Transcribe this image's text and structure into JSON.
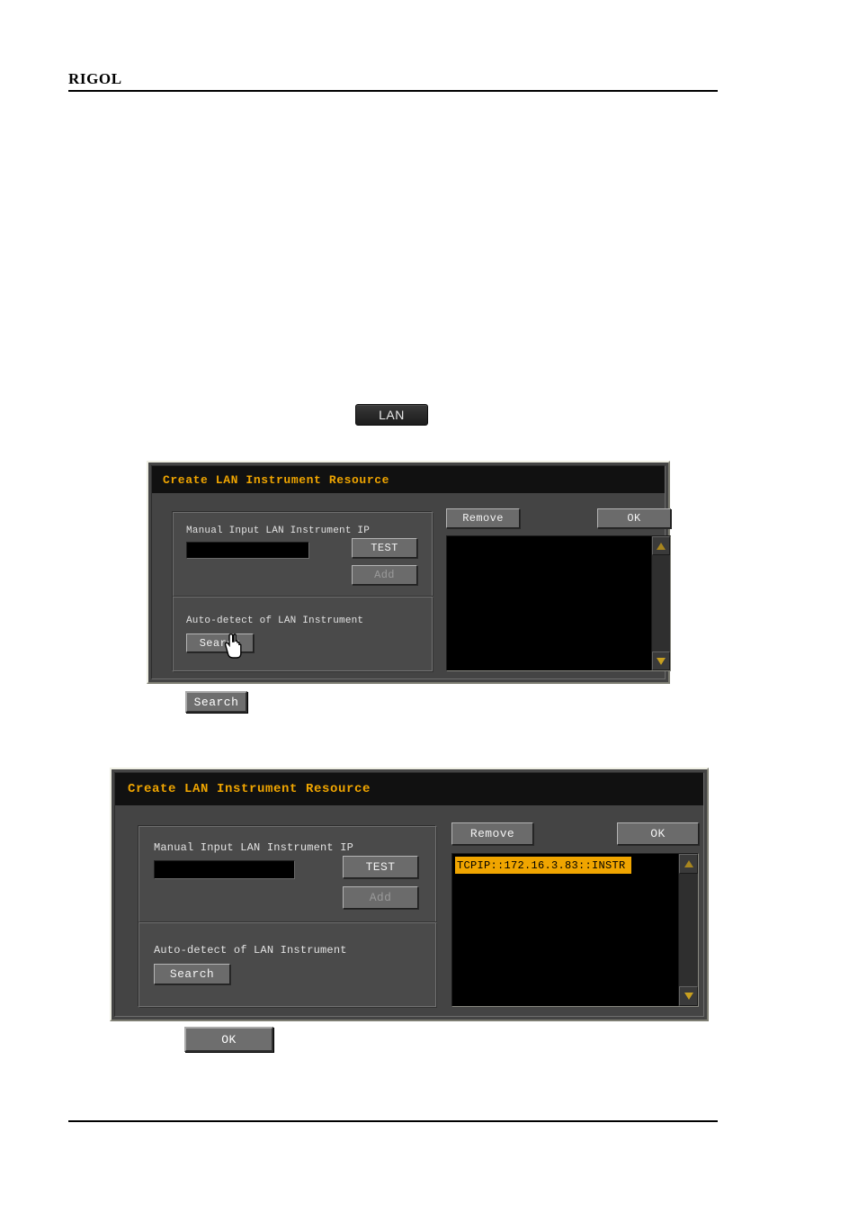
{
  "page": {
    "brand": "RIGOL"
  },
  "lan_key": {
    "label": "LAN"
  },
  "standalone_buttons": {
    "search": "Search",
    "ok": "OK"
  },
  "dialog1": {
    "title": "Create LAN Instrument Resource",
    "manual_group": {
      "label": "Manual Input LAN Instrument IP",
      "input_value": "",
      "input_placeholder": "",
      "test_button": "TEST",
      "add_button": "Add",
      "add_disabled": true
    },
    "auto_group": {
      "label": "Auto-detect of LAN Instrument",
      "search_button": "Search"
    },
    "right_panel": {
      "remove_button": "Remove",
      "ok_button": "OK",
      "list_items": [],
      "scroll_up_icon": "triangle-up-icon",
      "scroll_down_icon": "triangle-down-icon"
    },
    "cursor": "hand-cursor"
  },
  "dialog2": {
    "title": "Create LAN Instrument Resource",
    "manual_group": {
      "label": "Manual Input LAN Instrument IP",
      "input_value": "",
      "input_placeholder": "",
      "test_button": "TEST",
      "add_button": "Add",
      "add_disabled": true
    },
    "auto_group": {
      "label": "Auto-detect of LAN Instrument",
      "search_button": "Search"
    },
    "right_panel": {
      "remove_button": "Remove",
      "ok_button": "OK",
      "list_items": [
        "TCPIP::172.16.3.83::INSTR"
      ],
      "selected_item": "TCPIP::172.16.3.83::INSTR",
      "scroll_up_icon": "triangle-up-icon",
      "scroll_down_icon": "triangle-down-icon"
    }
  },
  "colors": {
    "title_amber": "#f0a500",
    "dialog_bg": "#444444",
    "titlebar_bg": "#111111",
    "list_bg": "#000000",
    "selection_bg": "#f0a500"
  }
}
